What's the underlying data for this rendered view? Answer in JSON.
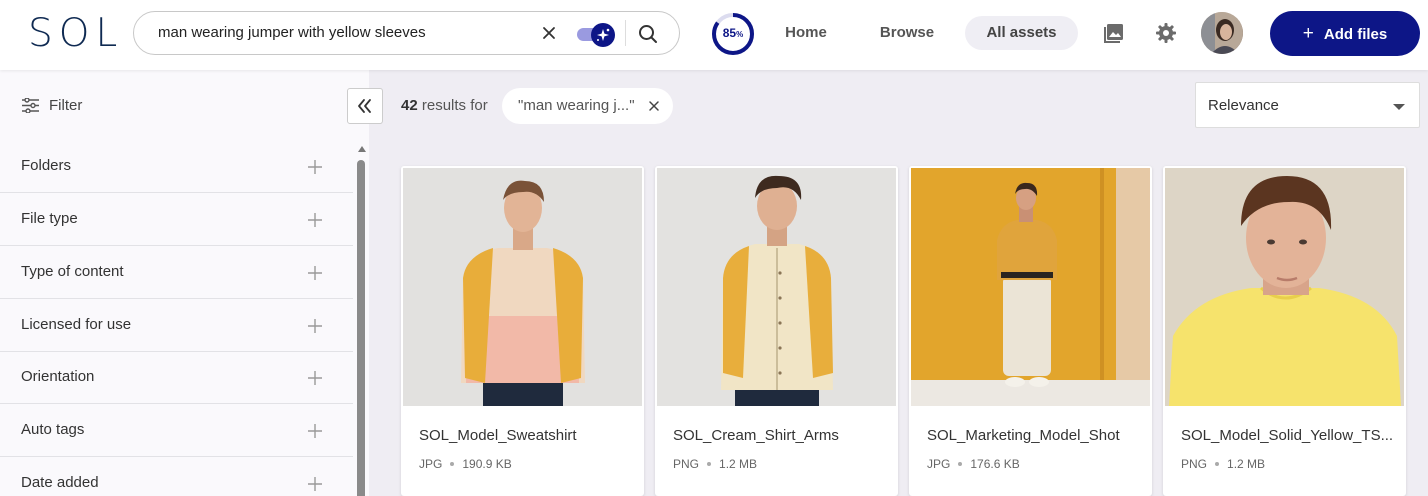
{
  "header": {
    "logo": "SOL",
    "search": {
      "value": "man wearing jumper with yellow sleeves"
    },
    "ai_toggle_on": true,
    "progress": {
      "value": "85",
      "unit": "%"
    },
    "nav": {
      "home": "Home",
      "browse": "Browse",
      "all_assets": "All assets"
    },
    "icons": {
      "clear": "close-icon",
      "search": "search-icon",
      "image": "image-icon",
      "settings": "gear-icon",
      "ai": "sparkle-icon"
    },
    "add_files": "Add files"
  },
  "sidebar": {
    "filter_label": "Filter",
    "facets": [
      {
        "label": "Folders"
      },
      {
        "label": "File type"
      },
      {
        "label": "Type of content"
      },
      {
        "label": "Licensed for use"
      },
      {
        "label": "Orientation"
      },
      {
        "label": "Auto tags"
      },
      {
        "label": "Date added"
      }
    ]
  },
  "results": {
    "count": "42",
    "count_suffix": "results for",
    "query_chip": "\"man wearing j...\"",
    "sort": "Relevance"
  },
  "assets": [
    {
      "name": "SOL_Model_Sweatshirt",
      "type": "JPG",
      "size": "190.9 KB"
    },
    {
      "name": "SOL_Cream_Shirt_Arms",
      "type": "PNG",
      "size": "1.2 MB"
    },
    {
      "name": "SOL_Marketing_Model_Shot",
      "type": "JPG",
      "size": "176.6 KB"
    },
    {
      "name": "SOL_Model_Solid_Yellow_TS...",
      "type": "PNG",
      "size": "1.2 MB"
    }
  ],
  "colors": {
    "brand": "#0d1687",
    "logo": "#0f2a52",
    "accent_light": "#9a9ae0",
    "main_bg": "#efedf3",
    "sidebar_bg": "#faf9fc"
  }
}
